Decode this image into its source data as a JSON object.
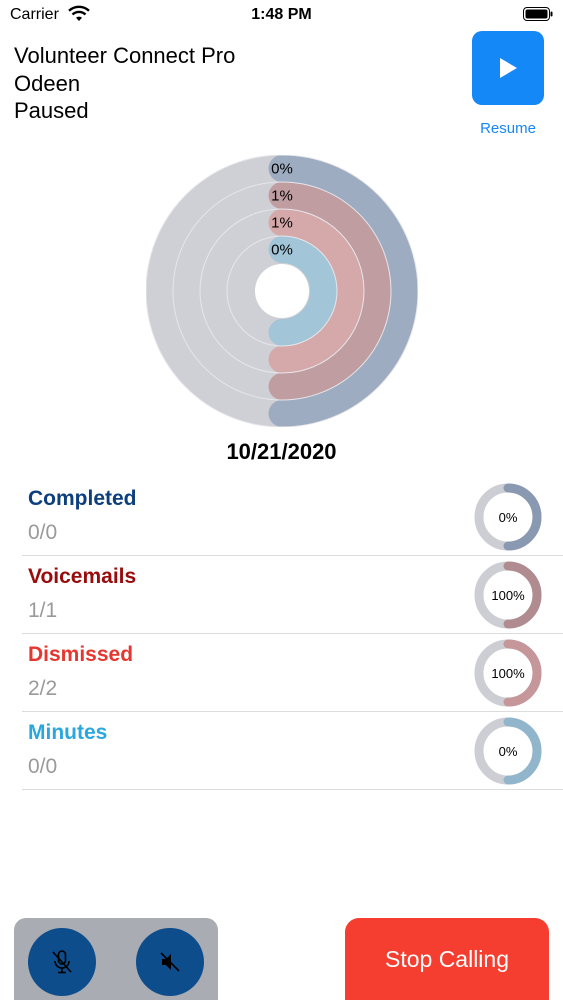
{
  "status_bar": {
    "carrier": "Carrier",
    "time": "1:48 PM"
  },
  "header": {
    "app_title": "Volunteer Connect Pro",
    "user_name": "Odeen",
    "state": "Paused",
    "resume_label": "Resume",
    "resume_icon": "play-icon",
    "accent_color": "#1488f7"
  },
  "chart_data": {
    "type": "radial-progress",
    "rings": [
      {
        "name": "Completed",
        "label": "0%",
        "value": 0,
        "color": "#1f4e8f"
      },
      {
        "name": "Voicemails",
        "label": "1%",
        "value": 1,
        "color": "#9a1b1b"
      },
      {
        "name": "Dismissed",
        "label": "1%",
        "value": 1,
        "color": "#e4403a"
      },
      {
        "name": "Minutes",
        "label": "0%",
        "value": 0,
        "color": "#2ea8de"
      }
    ]
  },
  "date": "10/21/2020",
  "stats": [
    {
      "title": "Completed",
      "value": "0/0",
      "percent_label": "0%",
      "fraction": 0,
      "color": "#0d3f7f"
    },
    {
      "title": "Voicemails",
      "value": "1/1",
      "percent_label": "100%",
      "fraction": 1,
      "color": "#980c0c"
    },
    {
      "title": "Dismissed",
      "value": "2/2",
      "percent_label": "100%",
      "fraction": 1,
      "color": "#e5372f"
    },
    {
      "title": "Minutes",
      "value": "0/0",
      "percent_label": "0%",
      "fraction": 0,
      "color": "#2aa7df"
    }
  ],
  "controls": {
    "mic_icon": "mic-muted-icon",
    "speaker_icon": "speaker-muted-icon",
    "stop_label": "Stop Calling",
    "stop_color": "#f53d30"
  }
}
